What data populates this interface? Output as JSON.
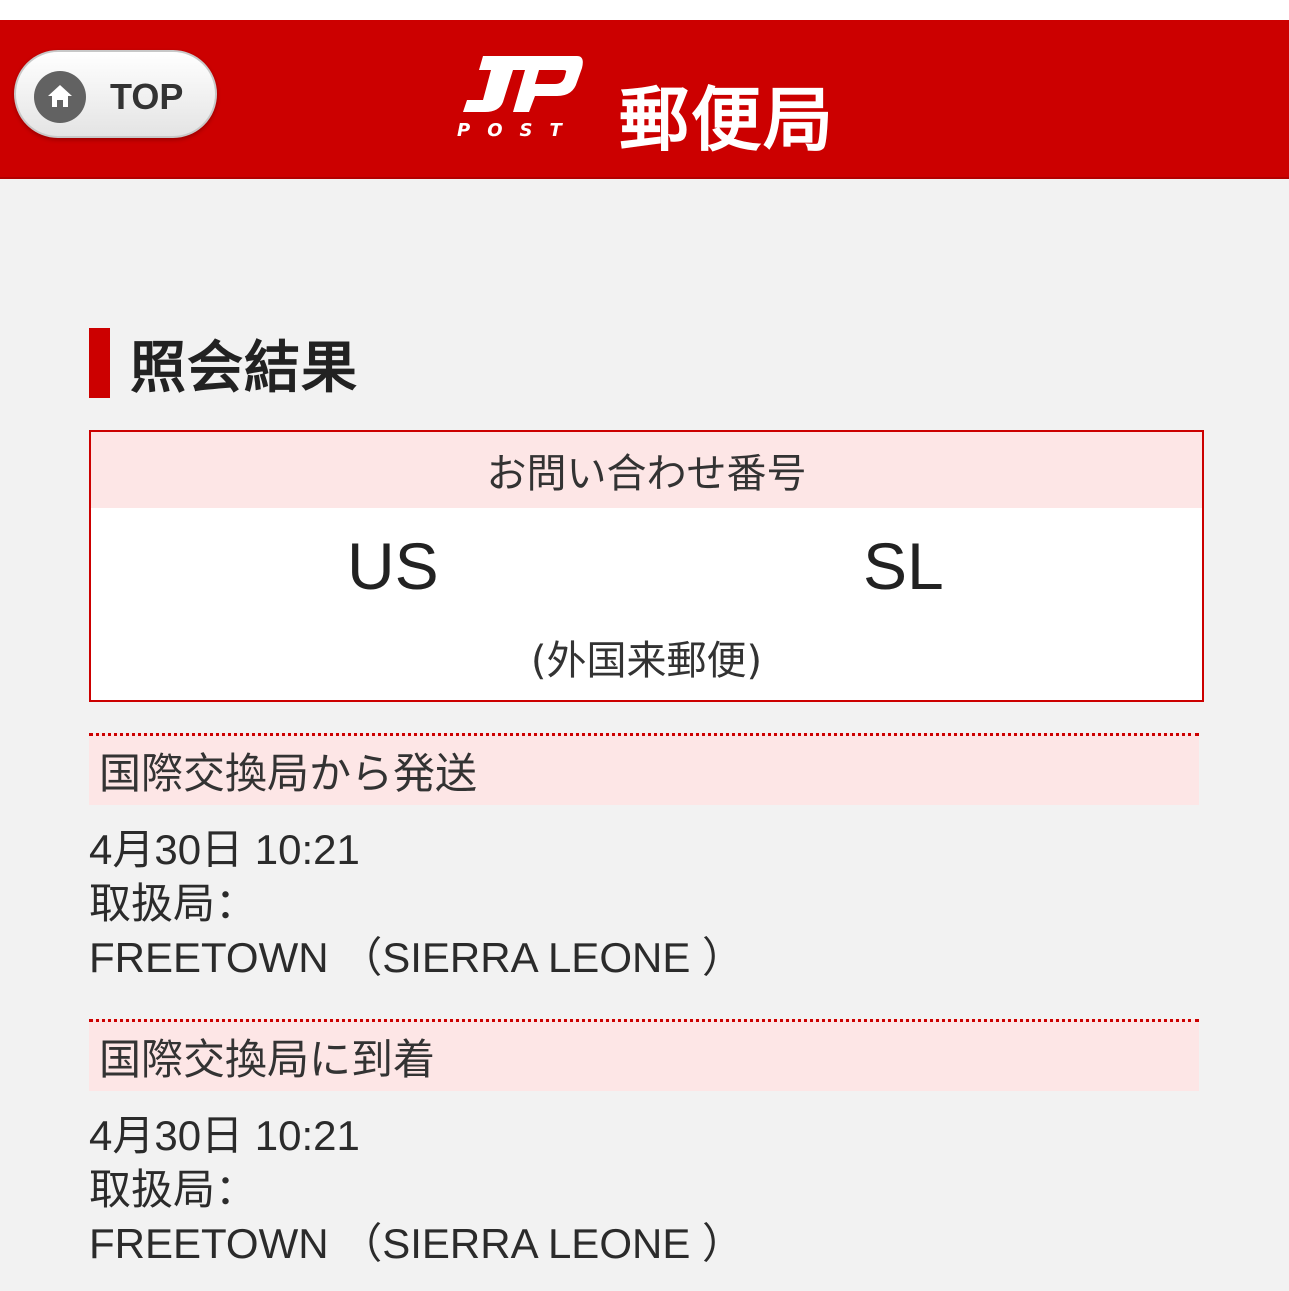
{
  "header": {
    "top_button_label": "TOP",
    "logo_mark": "JP",
    "logo_post": "POST",
    "logo_title": "郵便局",
    "brand_color": "#cc0000"
  },
  "result": {
    "title": "照会結果",
    "inquiry_label": "お問い合わせ番号",
    "number_prefix": "US",
    "number_suffix": "SL",
    "mail_type": "(外国来郵便)"
  },
  "events": [
    {
      "status": "国際交換局から発送",
      "datetime": "4月30日 10:21",
      "office_label": "取扱局：",
      "office": "FREETOWN （SIERRA LEONE ）"
    },
    {
      "status": "国際交換局に到着",
      "datetime": "4月30日 10:21",
      "office_label": "取扱局：",
      "office": "FREETOWN （SIERRA LEONE ）"
    }
  ]
}
